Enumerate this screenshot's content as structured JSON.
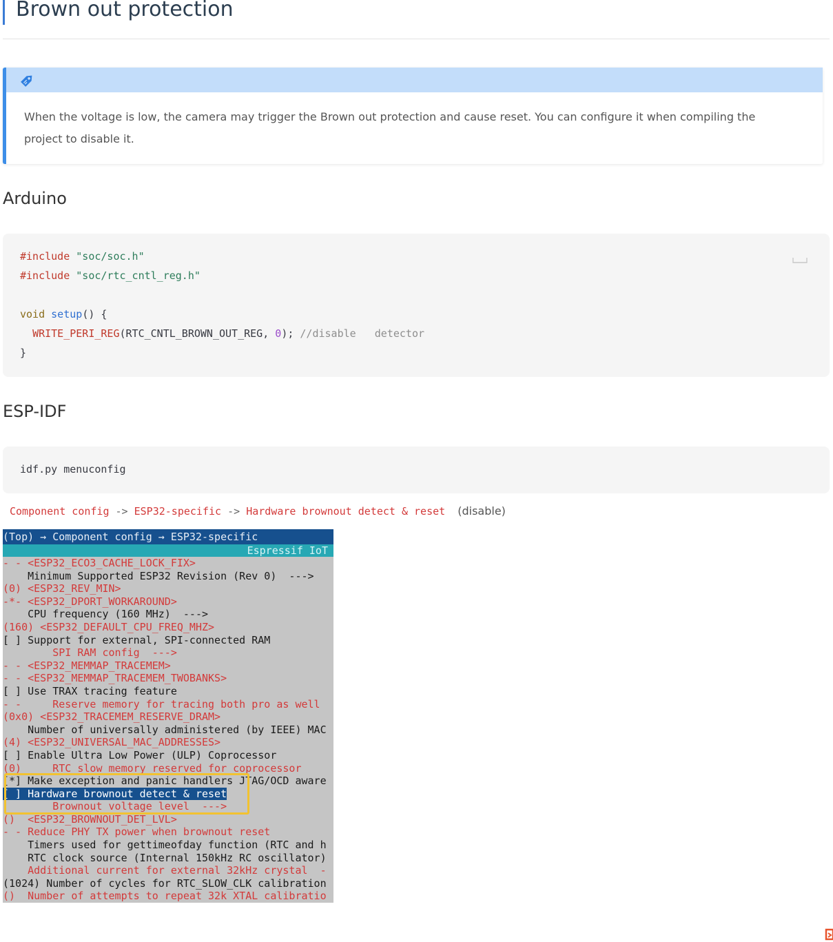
{
  "title": "Brown out protection",
  "callout": {
    "icon": "tag-icon",
    "text": "When the voltage is low, the camera may trigger the Brown out protection and cause reset. You can configure it when compiling the project to disable it."
  },
  "sections": {
    "arduino": "Arduino",
    "espidf": "ESP-IDF"
  },
  "arduino_code": {
    "include_kw": "#include",
    "include1": "\"soc/soc.h\"",
    "include2": "\"soc/rtc_cntl_reg.h\"",
    "void_kw": "void",
    "setup_fn": "setup",
    "setup_rest": "() {",
    "call_fn": "WRITE_PERI_REG",
    "call_args": "(RTC_CNTL_BROWN_OUT_REG, ",
    "call_num": "0",
    "call_end": "); ",
    "comment": "//disable   detector",
    "close": "}"
  },
  "espidf_cmd": "idf.py menuconfig",
  "path": {
    "seg1": "Component config",
    "arrow": " -> ",
    "seg2": "ESP32-specific",
    "seg3": "Hardware brownout detect & reset",
    "note": "(disable)"
  },
  "terminal": {
    "header": "(Top) → Component config → ESP32-specific",
    "subheader": "Espressif IoT",
    "lines": [
      {
        "text": "- - <ESP32_ECO3_CACHE_LOCK_FIX>",
        "red": true
      },
      {
        "text": "    Minimum Supported ESP32 Revision (Rev 0)  --->",
        "red": false
      },
      {
        "text": "(0) <ESP32_REV_MIN>",
        "red": true
      },
      {
        "text": "-*- <ESP32_DPORT_WORKAROUND>",
        "red": true
      },
      {
        "text": "    CPU frequency (160 MHz)  --->",
        "red": false
      },
      {
        "text": "(160) <ESP32_DEFAULT_CPU_FREQ_MHZ>",
        "red": true
      },
      {
        "text": "[ ] Support for external, SPI-connected RAM",
        "red": false
      },
      {
        "text": "        SPI RAM config  --->",
        "red": true
      },
      {
        "text": "- - <ESP32_MEMMAP_TRACEMEM>",
        "red": true
      },
      {
        "text": "- - <ESP32_MEMMAP_TRACEMEM_TWOBANKS>",
        "red": true
      },
      {
        "text": "[ ] Use TRAX tracing feature",
        "red": false
      },
      {
        "text": "- -     Reserve memory for tracing both pro as well",
        "red": true
      },
      {
        "text": "(0x0) <ESP32_TRACEMEM_RESERVE_DRAM>",
        "red": true
      },
      {
        "text": "    Number of universally administered (by IEEE) MAC",
        "red": false
      },
      {
        "text": "(4) <ESP32_UNIVERSAL_MAC_ADDRESSES>",
        "red": true
      },
      {
        "text": "[ ] Enable Ultra Low Power (ULP) Coprocessor",
        "red": false
      },
      {
        "text": "(0)     RTC slow memory reserved for coprocessor",
        "red": true
      },
      {
        "text": "[*] Make exception and panic handlers JTAG/OCD aware",
        "red": false
      },
      {
        "text": "[ ] Hardware brownout detect & reset",
        "red": false,
        "selected": true
      },
      {
        "text": "        Brownout voltage level  --->",
        "red": true
      },
      {
        "text": "()  <ESP32_BROWNOUT_DET_LVL>",
        "red": true
      },
      {
        "text": "- - Reduce PHY TX power when brownout reset",
        "red": true
      },
      {
        "text": "    Timers used for gettimeofday function (RTC and h",
        "red": false
      },
      {
        "text": "    RTC clock source (Internal 150kHz RC oscillator)",
        "red": false
      },
      {
        "text": "    Additional current for external 32kHz crystal  -",
        "red": true
      },
      {
        "text": "(1024) Number of cycles for RTC_SLOW_CLK calibration",
        "red": false
      },
      {
        "text": "()  Number of attempts to repeat 32k XTAL calibratio",
        "red": true
      }
    ]
  },
  "colors": {
    "accent": "#3d8ee8",
    "terminal_bg": "#c5c5c5",
    "terminal_header": "#16508e",
    "highlight_box": "#f2c230",
    "menu_red": "#d33a3a"
  }
}
